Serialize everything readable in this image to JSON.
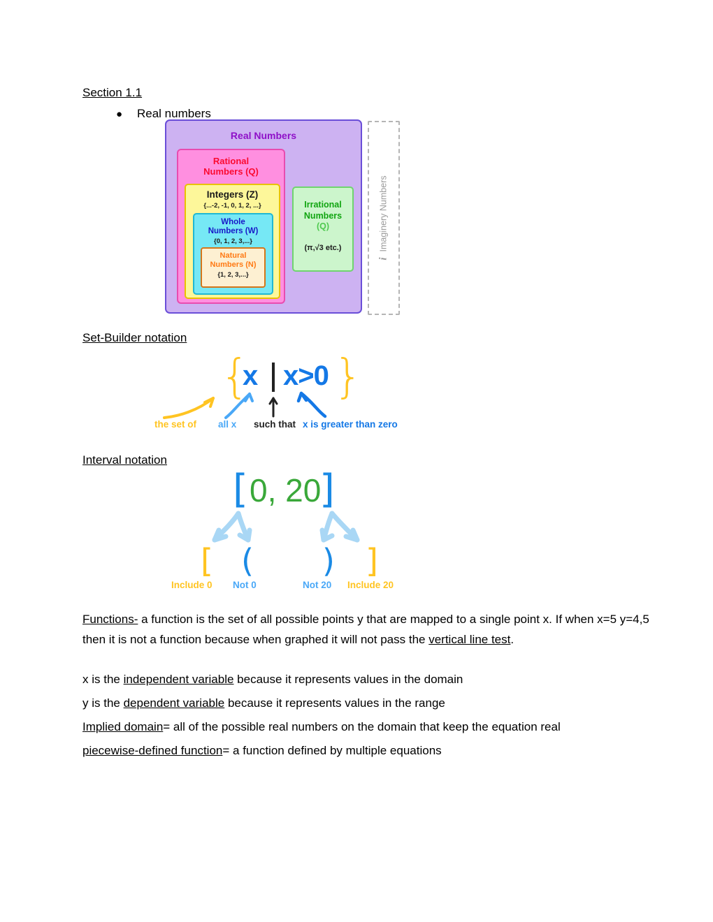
{
  "document": {
    "section_heading": "Section 1.1",
    "bullet": "Real numbers",
    "bullet_glyph": "●"
  },
  "real_numbers_diagram": {
    "real": {
      "title": "Real Numbers",
      "fill": "#cdb2f2",
      "border": "#6a4ed8",
      "text_color": "#8f10c8"
    },
    "rational": {
      "title_line1": "Rational",
      "title_line2": "Numbers (Q)",
      "fill": "#ff8fe0",
      "border": "#e84cb0",
      "text_color": "#fb0a30"
    },
    "integers": {
      "title": "Integers (Z)",
      "set": "{...-2, -1, 0, 1, 2, ...}",
      "fill": "#fdf79a",
      "border": "#e8c200",
      "text_color": "#1a1a1a"
    },
    "whole": {
      "title_line1": "Whole",
      "title_line2": "Numbers (W)",
      "set": "{0, 1, 2, 3,...}",
      "fill": "#76e8f5",
      "border": "#1fb8d4",
      "text_color": "#1818c8"
    },
    "natural": {
      "title_line1": "Natural",
      "title_line2": "Numbers (N)",
      "set": "{1, 2, 3,...}",
      "fill": "#fdf0d2",
      "border": "#d4761a",
      "text_color": "#ff7a14"
    },
    "irrational": {
      "title_line1": "Irrational",
      "title_line2": "Numbers",
      "symbol": "(Q)",
      "examples": "(π,√3 etc.)",
      "fill": "#ccf5cc",
      "border": "#6fd46f",
      "text_color": "#11a511"
    },
    "imaginary": {
      "i_symbol": "i",
      "label": "Imaginery Numbers",
      "border": "#b5b5b5",
      "text_color": "#9b9b9b"
    }
  },
  "set_builder": {
    "heading": "Set-Builder notation",
    "brace_left": "{",
    "brace_right": "}",
    "variable": "x",
    "condition": "x>0",
    "labels": {
      "set_of": "the set of",
      "all_x": "all x",
      "such_that": "such that",
      "greater_zero": "x is greater than zero"
    },
    "colors": {
      "brace": "#ffc422",
      "variable": "#1478e6",
      "bar": "#222222",
      "all_x_label": "#4aa8f7",
      "condition_label": "#1478e6"
    }
  },
  "interval": {
    "heading": "Interval notation",
    "bracket_left": "[",
    "bracket_right": "]",
    "numbers": "0, 20",
    "symbols": {
      "include_low": "[",
      "exclude_low": "(",
      "exclude_high": ")",
      "include_high": "]"
    },
    "labels": {
      "include_low": "Include 0",
      "exclude_low": "Not 0",
      "exclude_high": "Not 20",
      "include_high": "Include 20"
    },
    "colors": {
      "bracket": "#1a8ae5",
      "numbers": "#3aa83a",
      "include": "#ffc422",
      "exclude": "#1a8ae5",
      "arrow": "#a9d7f5"
    }
  },
  "notes": {
    "functions_term": "Functions-",
    "functions_body_1": " a function is the set of all possible points y that are mapped to a single point x. If when x=5 y=4,5 then it is not a function because when graphed it will not pass the ",
    "functions_underline_2": "vertical line test",
    "functions_body_2": ".",
    "independent_pre": "x is the ",
    "independent_term": "independent variable",
    "independent_post": " because it represents values in the domain",
    "dependent_pre": "y is the ",
    "dependent_term": "dependent variable",
    "dependent_post": " because it represents values in the range",
    "implied_term": "Implied domain",
    "implied_post": "= all of the possible real numbers on the domain that keep the equation real",
    "piecewise_term": "piecewise-defined function",
    "piecewise_post": "= a function defined by multiple equations"
  }
}
